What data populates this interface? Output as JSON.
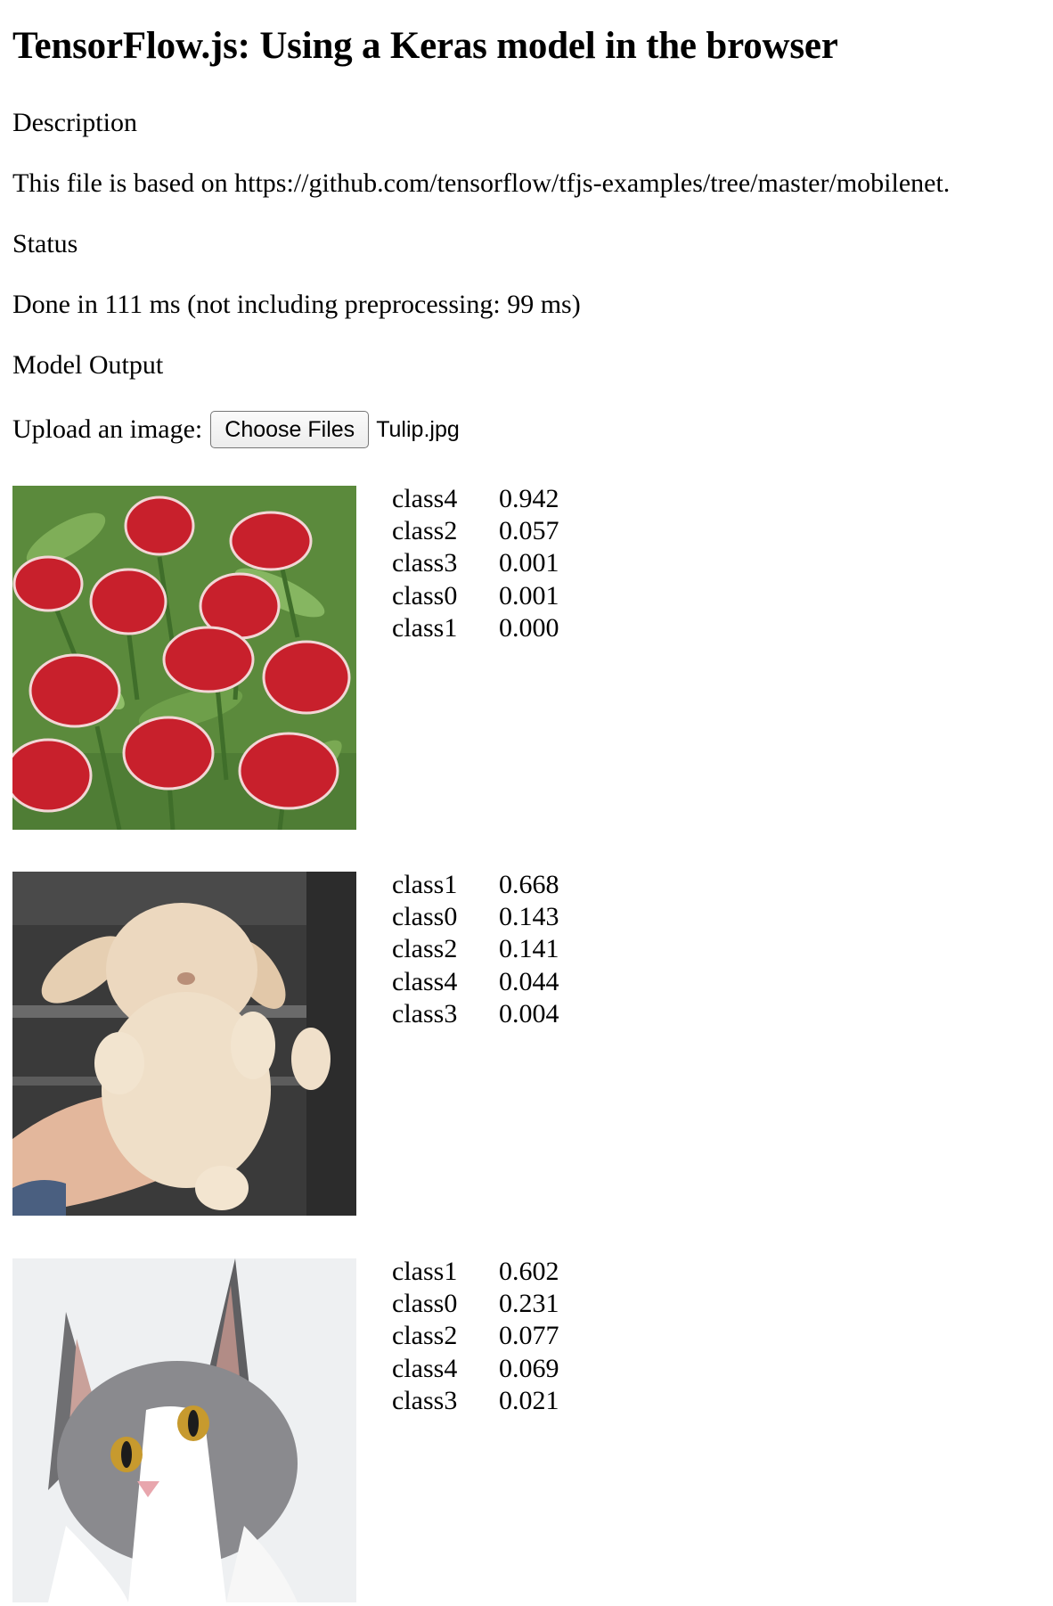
{
  "title": "TensorFlow.js: Using a Keras model in the browser",
  "description": {
    "heading": "Description",
    "text": "This file is based on https://github.com/tensorflow/tfjs-examples/tree/master/mobilenet."
  },
  "status": {
    "heading": "Status",
    "text": "Done in 111 ms (not including preprocessing: 99 ms)"
  },
  "model_output": {
    "heading": "Model Output"
  },
  "upload": {
    "label": "Upload an image:",
    "button_label": "Choose Files",
    "file_name": "Tulip.jpg"
  },
  "results": [
    {
      "image_icon": "tulips-photo",
      "predictions": [
        {
          "class": "class4",
          "prob": "0.942"
        },
        {
          "class": "class2",
          "prob": "0.057"
        },
        {
          "class": "class3",
          "prob": "0.001"
        },
        {
          "class": "class0",
          "prob": "0.001"
        },
        {
          "class": "class1",
          "prob": "0.000"
        }
      ]
    },
    {
      "image_icon": "rabbit-photo",
      "predictions": [
        {
          "class": "class1",
          "prob": "0.668"
        },
        {
          "class": "class0",
          "prob": "0.143"
        },
        {
          "class": "class2",
          "prob": "0.141"
        },
        {
          "class": "class4",
          "prob": "0.044"
        },
        {
          "class": "class3",
          "prob": "0.004"
        }
      ]
    },
    {
      "image_icon": "cat-photo",
      "predictions": [
        {
          "class": "class1",
          "prob": "0.602"
        },
        {
          "class": "class0",
          "prob": "0.231"
        },
        {
          "class": "class2",
          "prob": "0.077"
        },
        {
          "class": "class4",
          "prob": "0.069"
        },
        {
          "class": "class3",
          "prob": "0.021"
        }
      ]
    }
  ]
}
